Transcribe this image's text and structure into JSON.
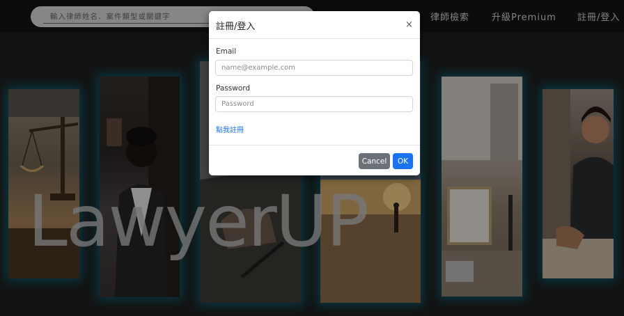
{
  "navbar": {
    "search_placeholder": "輸入律師姓名、案件類型或關鍵字",
    "links": [
      "律師檢索",
      "升級Premium",
      "註冊/登入"
    ]
  },
  "hero": {
    "brand": "LawyerUP"
  },
  "modal": {
    "title": "註冊/登入",
    "close_symbol": "×",
    "email_label": "Email",
    "email_placeholder": "name@example.com",
    "password_label": "Password",
    "password_placeholder": "Password",
    "register_link": "點我註冊",
    "cancel_label": "Cancel",
    "ok_label": "OK"
  },
  "colors": {
    "accent_blue": "#1a73f0",
    "cancel_gray": "#6b7177",
    "panel_glow": "#008caa"
  }
}
